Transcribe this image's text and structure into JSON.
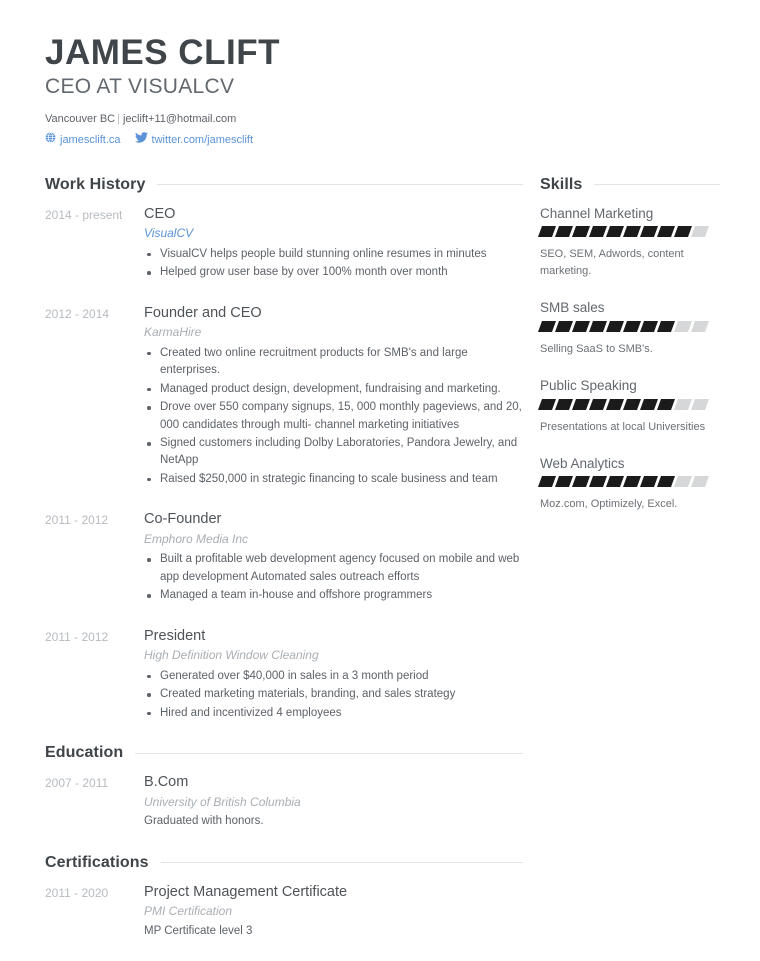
{
  "header": {
    "name": "JAMES CLIFT",
    "headline": "CEO AT VISUALCV",
    "location": "Vancouver BC",
    "separator": "|",
    "email": "jeclift+11@hotmail.com",
    "website": "jamesclift.ca",
    "twitter": "twitter.com/jamesclift",
    "website_icon": "globe-icon",
    "twitter_icon": "twitter-bird-icon",
    "link_color": "#5b93d6"
  },
  "sections": {
    "work": {
      "title": "Work History",
      "entries": [
        {
          "date": "2014 - present",
          "title": "CEO",
          "org": "VisualCV",
          "org_accent": true,
          "bullets": [
            "VisualCV helps people build stunning online resumes in minutes",
            "Helped grow user base by over 100% month over month"
          ]
        },
        {
          "date": "2012 - 2014",
          "title": "Founder and CEO",
          "org": "KarmaHire",
          "org_accent": false,
          "bullets": [
            "Created two online recruitment products for SMB's and large enterprises.",
            "Managed product design, development, fundraising and marketing.",
            "Drove over 550 company signups, 15, 000 monthly pageviews, and 20, 000 candidates through multi- channel marketing initiatives",
            "Signed customers including Dolby Laboratories, Pandora Jewelry, and NetApp",
            "Raised $250,000 in strategic financing to scale business and team"
          ]
        },
        {
          "date": "2011 - 2012",
          "title": "Co-Founder",
          "org": "Emphoro Media Inc",
          "org_accent": false,
          "bullets": [
            "Built a profitable web development agency focused on mobile and web app development Automated sales outreach efforts",
            "Managed a team in-house and offshore programmers"
          ]
        },
        {
          "date": "2011 - 2012",
          "title": "President",
          "org": "High Definition Window Cleaning",
          "org_accent": false,
          "bullets": [
            "Generated over $40,000 in sales in a 3 month period",
            "Created marketing materials, branding, and sales strategy",
            "Hired and incentivized 4 employees"
          ]
        }
      ]
    },
    "education": {
      "title": "Education",
      "entries": [
        {
          "date": "2007 - 2011",
          "title": "B.Com",
          "org": "University of British Columbia",
          "note": "Graduated with honors."
        }
      ]
    },
    "certifications": {
      "title": "Certifications",
      "entries": [
        {
          "date": "2011 - 2020",
          "title": "Project Management Certificate",
          "org": "PMI Certification",
          "note": "MP Certificate level 3"
        }
      ]
    },
    "skills": {
      "title": "Skills",
      "max_rating": 10,
      "items": [
        {
          "name": "Channel Marketing",
          "rating": 9,
          "description": "SEO, SEM, Adwords, content marketing."
        },
        {
          "name": "SMB sales",
          "rating": 8,
          "description": "Selling SaaS to SMB's."
        },
        {
          "name": "Public Speaking",
          "rating": 8,
          "description": "Presentations at local Universities"
        },
        {
          "name": "Web Analytics",
          "rating": 8,
          "description": "Moz.com, Optimizely, Excel."
        }
      ]
    }
  }
}
